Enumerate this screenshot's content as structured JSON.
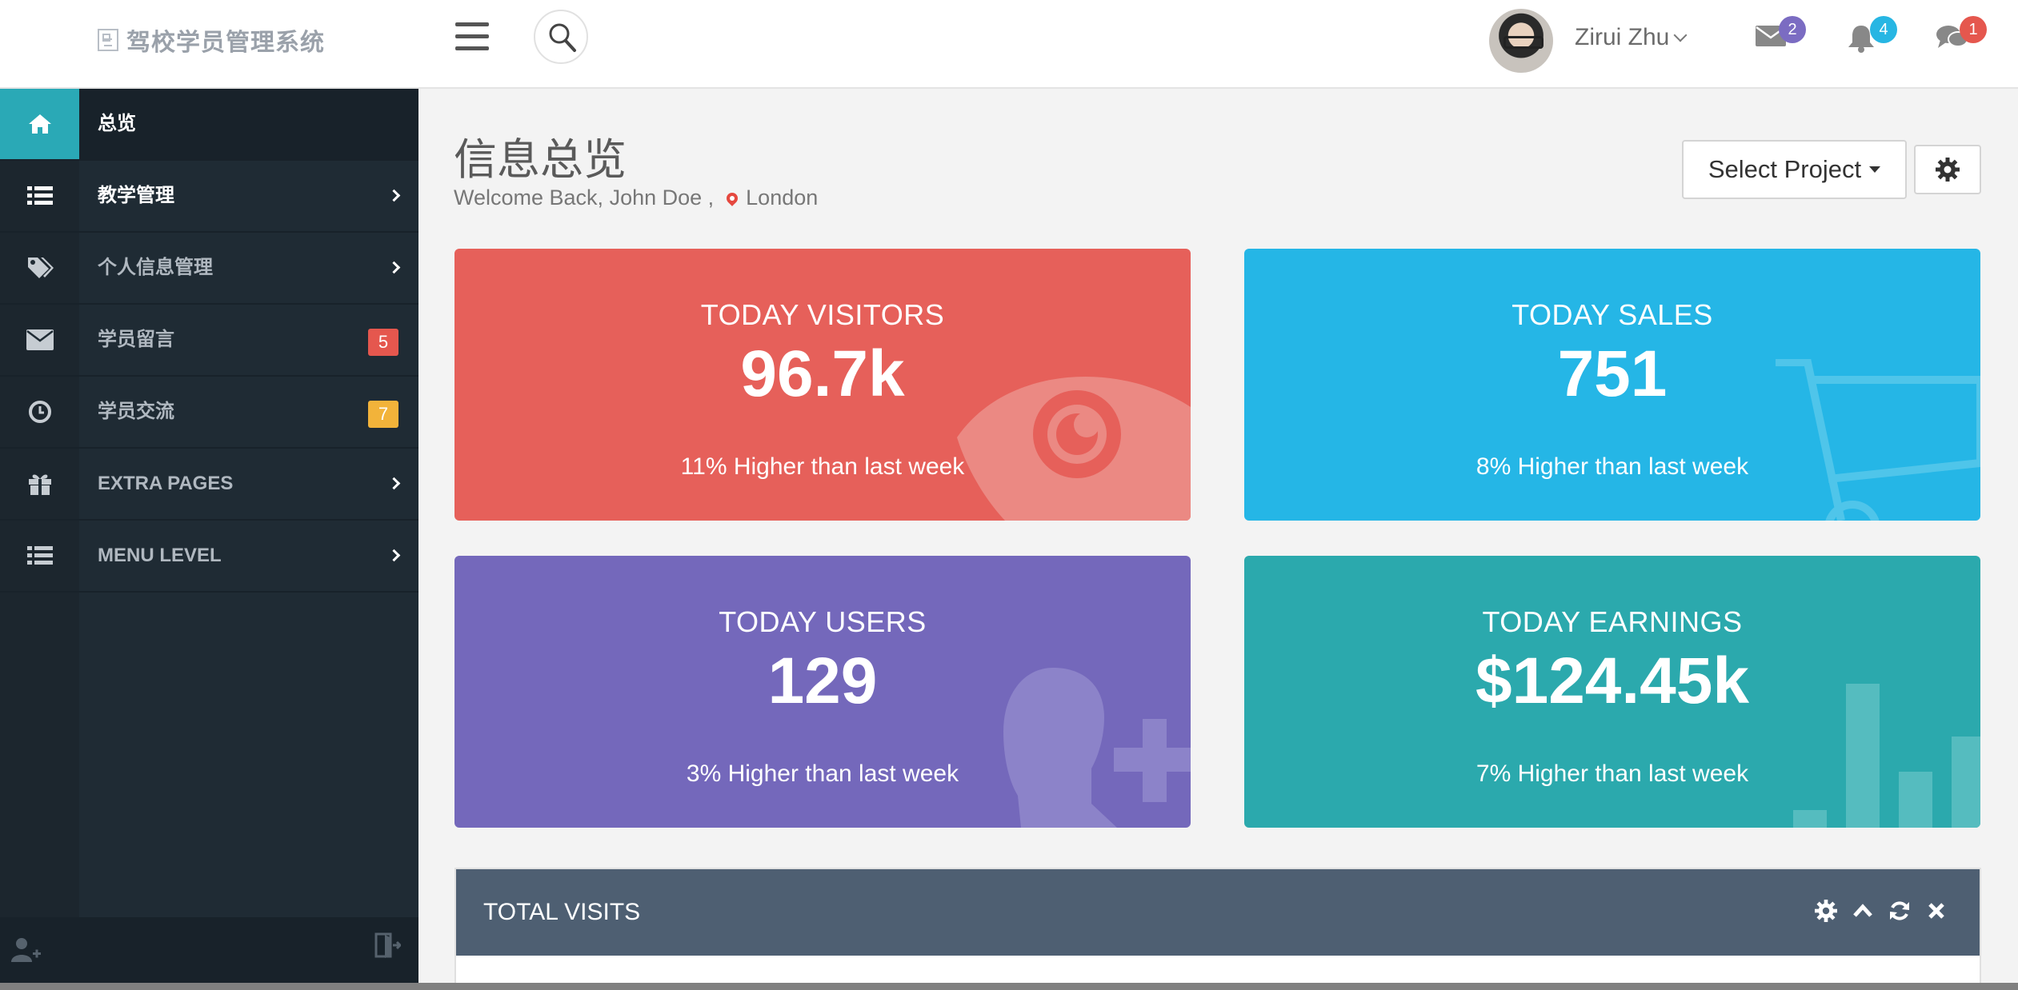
{
  "header": {
    "brand": "驾校学员管理系统",
    "user_name": "Zirui Zhu",
    "notifications": [
      {
        "name": "mail",
        "count": "2",
        "color": "#7b6cc2"
      },
      {
        "name": "bell",
        "count": "4",
        "color": "#27b6e3"
      },
      {
        "name": "chat",
        "count": "1",
        "color": "#e5574e"
      }
    ]
  },
  "sidebar": {
    "items": [
      {
        "label": "总览",
        "icon": "home-icon"
      },
      {
        "label": "教学管理",
        "icon": "list-icon"
      },
      {
        "label": "个人信息管理",
        "icon": "tags-icon"
      },
      {
        "label": "学员留言",
        "icon": "envelope-icon",
        "badge": "5"
      },
      {
        "label": "学员交流",
        "icon": "clock-icon",
        "badge": "7"
      },
      {
        "label": "EXTRA PAGES",
        "icon": "gift-icon"
      },
      {
        "label": "MENU LEVEL",
        "icon": "list-icon"
      }
    ],
    "badge_colors": {
      "red": "#e5574e",
      "orange": "#f2b33a"
    }
  },
  "main": {
    "title": "信息总览",
    "welcome": "Welcome Back, John Doe ,",
    "location": "London",
    "select_project": "Select Project"
  },
  "stats": [
    {
      "title": "TODAY VISITORS",
      "value": "96.7k",
      "foot": "11% Higher than last week",
      "color": "#e6605a"
    },
    {
      "title": "TODAY SALES",
      "value": "751",
      "foot": "8% Higher than last week",
      "color": "#25b6e6"
    },
    {
      "title": "TODAY USERS",
      "value": "129",
      "foot": "3% Higher than last week",
      "color": "#7468bb"
    },
    {
      "title": "TODAY EARNINGS",
      "value": "$124.45k",
      "foot": "7% Higher than last week",
      "color": "#2ba9ad"
    }
  ],
  "panel": {
    "title": "TOTAL VISITS"
  }
}
